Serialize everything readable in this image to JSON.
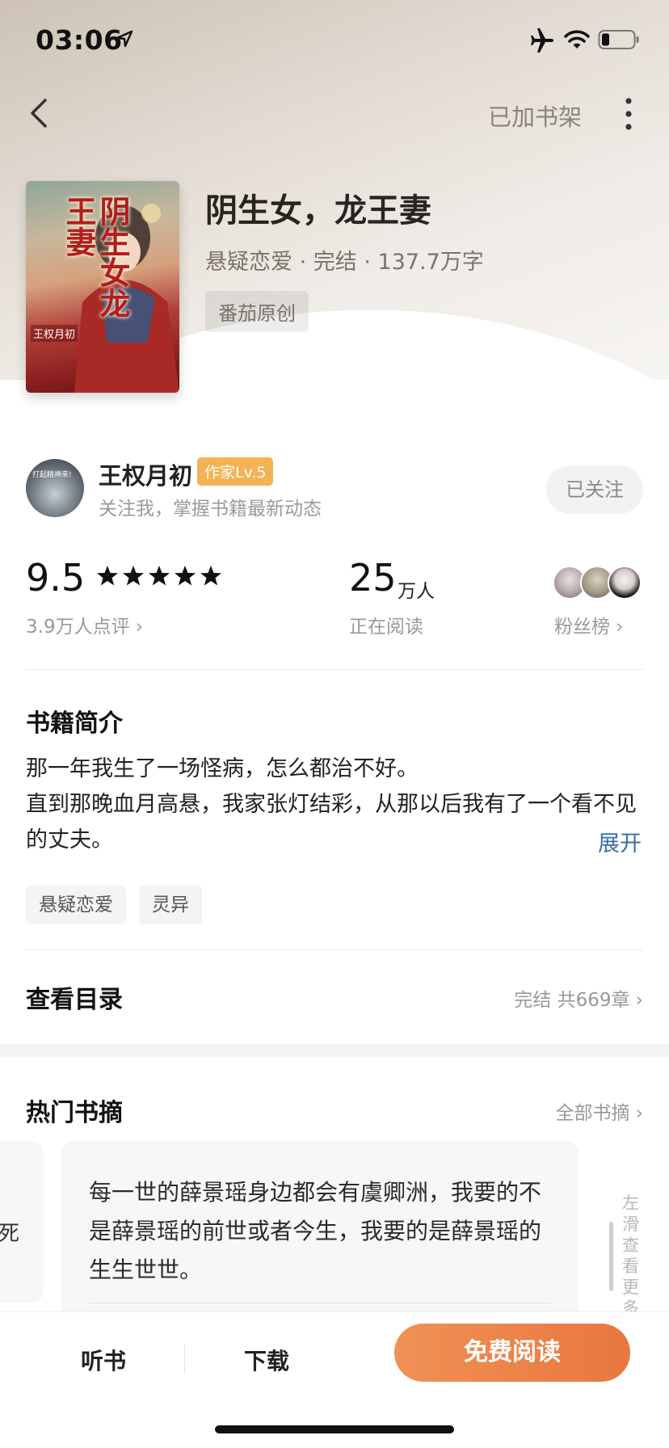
{
  "status_bar": {
    "time": "03:06",
    "icons": [
      "location-arrow-icon",
      "airplane-icon",
      "wifi-icon",
      "battery-icon"
    ]
  },
  "nav": {
    "back_icon": "chevron-left-icon",
    "shelf_label": "已加书架",
    "more_icon": "more-vertical-icon"
  },
  "book": {
    "cover_title": "阴生女龙王妻",
    "cover_author": "王权月初",
    "title": "阴生女，龙王妻",
    "meta": "悬疑恋爱 · 完结 · 137.7万字",
    "origin_tag": "番茄原创"
  },
  "author": {
    "avatar_text": "打起精神来!",
    "name": "王权月初",
    "level": "作家Lv.5",
    "subtitle": "关注我，掌握书籍最新动态",
    "follow_label": "已关注"
  },
  "stats": {
    "rating": "9.5",
    "stars": 5,
    "rating_count": "3.9万人点评 ›",
    "readers": "25",
    "readers_unit": "万人",
    "readers_label": "正在阅读",
    "fans_label": "粉丝榜 ›"
  },
  "intro": {
    "title": "书籍简介",
    "line1": "那一年我生了一场怪病，怎么都治不好。",
    "line2": "直到那晚血月高悬，我家张灯结彩，从那以后我有了一个看不见的丈夫。",
    "expand": "展开",
    "tags": [
      "悬疑恋爱",
      "灵异"
    ]
  },
  "toc": {
    "title": "查看目录",
    "info": "完结 共669章 ›"
  },
  "excerpts": {
    "title": "热门书摘",
    "all_label": "全部书摘 ›",
    "prev_char": "死",
    "text": "每一世的薛景瑶身边都会有虞卿洲，我要的不是薛景瑶的前世或者今生，我要的是薛景瑶的生生世世。",
    "side_hint": "左滑查看更多"
  },
  "bottom_bar": {
    "listen": "听书",
    "download": "下载",
    "read": "免费阅读"
  },
  "colors": {
    "accent": "#e8773f",
    "link": "#3a6ea8",
    "level_badge": "#f3b254"
  }
}
